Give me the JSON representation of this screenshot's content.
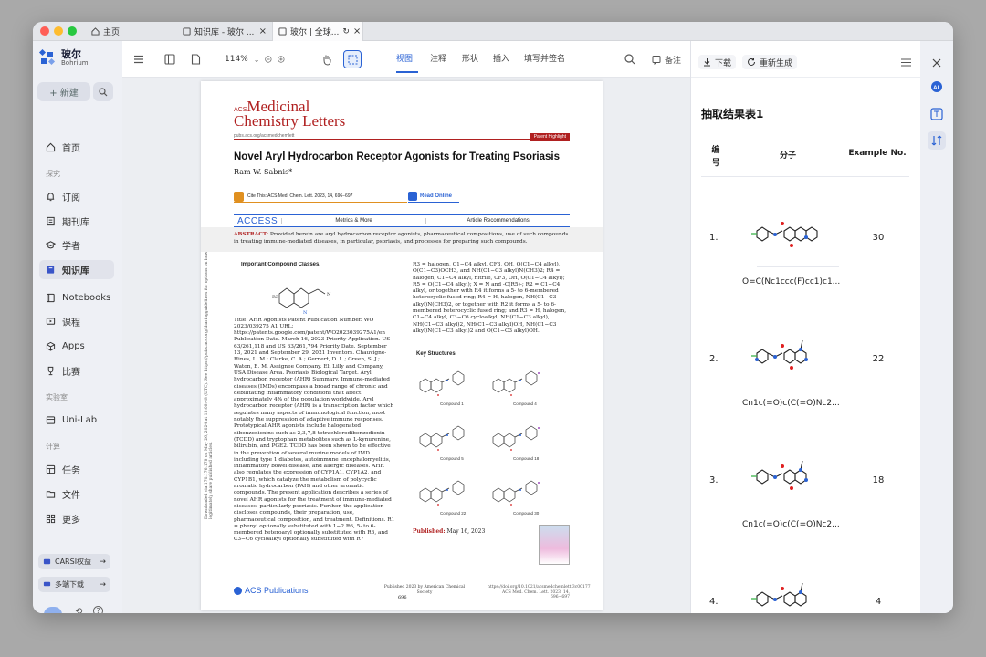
{
  "tabs": [
    {
      "label": "主页"
    },
    {
      "label": "知识库 - 玻尔 ..."
    },
    {
      "label": "玻尔 | 全球..."
    }
  ],
  "brand": {
    "name": "玻尔",
    "sub": "Bohrium"
  },
  "sidebar": {
    "new_label": "+ 新建",
    "items": [
      {
        "label": "首页"
      },
      {
        "label": "订阅"
      },
      {
        "label": "期刊库"
      },
      {
        "label": "学者"
      },
      {
        "label": "知识库"
      },
      {
        "label": "Notebooks"
      },
      {
        "label": "课程"
      },
      {
        "label": "Apps"
      },
      {
        "label": "比赛"
      },
      {
        "label": "Uni-Lab"
      },
      {
        "label": "任务"
      },
      {
        "label": "文件"
      },
      {
        "label": "更多"
      }
    ],
    "sections": [
      "探究",
      "实验室",
      "计算"
    ],
    "pills": [
      {
        "label": "CARSI权益"
      },
      {
        "label": "多端下载"
      }
    ]
  },
  "toolbar": {
    "zoom": "114%",
    "tabs": [
      "视图",
      "注释",
      "形状",
      "插入",
      "填写并签名"
    ],
    "note_label": "备注"
  },
  "paper": {
    "journal_prefix": "ACS",
    "journal_line1": "Medicinal",
    "journal_line2": "Chemistry Letters",
    "url": "pubs.acs.org/acsmedchemlett",
    "tag": "Patent Highlight",
    "title": "Novel Aryl Hydrocarbon Receptor Agonists for Treating Psoriasis",
    "author": "Ram W. Sabnis*",
    "cite": "Cite This: ACS Med. Chem. Lett. 2023, 14, 696−697",
    "read_online": "Read Online",
    "access": "ACCESS",
    "metrics": "Metrics & More",
    "recommendations": "Article Recommendations",
    "abstract_label": "ABSTRACT:",
    "abstract_text": "Provided herein are aryl hydrocarbon receptor agonists, pharmaceutical compositions, use of such compounds in treating immune-mediated diseases, in particular, psoriasis, and processes for preparing such compounds.",
    "important_classes": "Important Compound Classes.",
    "left_col": "Title. AHR Agonists Patent Publication Number. WO 2023/039275 A1 URL: https://patents.google.com/patent/WO2023039275A1/en Publication Date. March 16, 2023 Priority Application. US 63/261,118 and US 63/261,794 Priority Date. September 13, 2021 and September 29, 2021 Inventors. Chauvigne-Hines, L. M.; Clarke, C. A.; Gernert, D. L.; Green, S. J.; Waton, B. M. Assignee Company. Eli Lilly and Company, USA Disease Area. Psoriasis Biological Target. Aryl hydrocarbon receptor (AHR) Summary. Immune-mediated diseases (IMDs) encompass a broad range of chronic and debilitating inflammatory conditions that affect approximately 4% of the population worldwide. Aryl hydrocarbon receptor (AHR) is a transcription factor which regulates many aspects of immunological function, most notably the suppression of adaptive immune responses. Prototypical AHR agonists include halogenated dibenzodioxins such as 2,3,7,8-tetrachlorodibenzodioxin (TCDD) and tryptophan metabolites such as L-kynurenine, bilirubin, and PGE2. TCDD has been shown to be effective in the prevention of several murine models of IMD including type 1 diabetes, autoimmune encephalomyelitis, inflammatory bowel disease, and allergic diseases. AHR also regulates the expression of CYP1A1, CYP1A2, and CYP1B1, which catalyze the metabolism of polycyclic aromatic hydrocarbon (PAH) and other aromatic compounds. The present application describes a series of novel AHR agonists for the treatment of immune-mediated diseases, particularly psoriasis. Further, the application discloses compounds, their preparation, use, pharmaceutical composition, and treatment. Definitions. R1 = phenyl optionally substituted with 1−2 R6, 5- to 6-membered heteroaryl optionally substituted with R6, and C3−C6 cycloalkyl optionally substituted with R7",
    "right_col": "R3 = halogen, C1−C4 alkyl, CF3, OH, O(C1−C4 alkyl), O(C1−C3)OCH3, and NH(C1−C3 alkyl)N(CH3)2; R4 = halogen, C1−C4 alkyl, nitrile, CF3, OH, O(C1−C4 alkyl); R5 = O(C1−C4 alkyl); X = N and -C(R5)-; R2 = C1−C4 alkyl, or together with R4 it forms a 5- to 6-membered heterocyclic fused ring; R4 = H, halogen, NH(C1−C3 alkyl)N(CH3)2, or together with R2 it forms a 5- to 6-membered heterocyclic fused ring; and R3 = H, halogen, C1−C4 alkyl, C3−C6 cycloalkyl, NH(C1−C3 alkyl), NH(C1−C3 alkyl)2, NH(C1−C3 alkyl)OH, NH(C1−C3 alkyl)N(C1−C3 alkyl)2 and O(C1−C3 alkyl)OH.",
    "key_structures": "Key Structures.",
    "compounds": [
      "Compound 1",
      "Compound 4",
      "Compound 5",
      "Compound 18",
      "Compound 22",
      "Compound 30"
    ],
    "published_label": "Published:",
    "published_date": "May 16, 2023",
    "publisher": "ACS Publications",
    "footer_pub": "Published 2023 by American Chemical Society",
    "page": "696",
    "doi": "https://doi.org/10.1021/acsmedchemlett.3c00177 ACS Med. Chem. Lett. 2023, 14, 696−697",
    "side_text": "Downloaded via 170.176.178 on May 26, 2024 at 13:08:48 (UTC). See https://pubs.acs.org/sharingguidelines for options on how to legitimately share published articles."
  },
  "panel": {
    "download": "下载",
    "regenerate": "重新生成",
    "title": "抽取结果表1",
    "columns": [
      "编号",
      "分子",
      "Example No."
    ],
    "rows": [
      {
        "no": "1.",
        "smiles": "O=C(Nc1ccc(F)cc1)c1...",
        "example": "30"
      },
      {
        "no": "2.",
        "smiles": "Cn1c(=O)c(C(=O)Nc2...",
        "example": "22"
      },
      {
        "no": "3.",
        "smiles": "Cn1c(=O)c(C(=O)Nc2...",
        "example": "18"
      },
      {
        "no": "4.",
        "smiles": "",
        "example": "4"
      }
    ]
  },
  "colors": {
    "accent": "#2a62d4",
    "journal_red": "#b02020",
    "fluorine_green": "#3cb44b"
  }
}
